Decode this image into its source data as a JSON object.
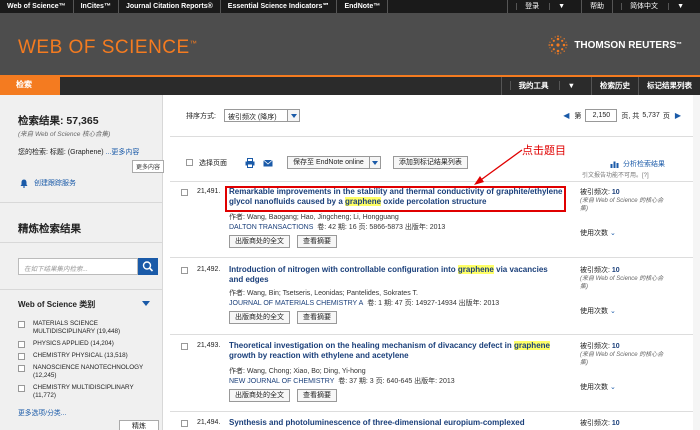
{
  "topbar": {
    "products": [
      "Web of Science™",
      "InCites™",
      "Journal Citation Reports®",
      "Essential Science Indicators℠",
      "EndNote™"
    ],
    "login": "登录",
    "help": "帮助",
    "language": "简体中文"
  },
  "header": {
    "logo": "WEB OF SCIENCE",
    "logo_tm": "™",
    "brand": "THOMSON REUTERS",
    "brand_tm": "™",
    "brand_color": "#f47b20"
  },
  "nav": {
    "active_tab": "检索",
    "links": [
      "我的工具",
      "检索历史",
      "标记结果列表"
    ]
  },
  "sidebar": {
    "results_label": "检索结果: 57,365",
    "results_sub": "(来自 Web of Science 核心合集)",
    "query_prefix": "您的检索: 标题: (Graphene)",
    "query_more": "...更多内容",
    "tooltip": "更多内容",
    "alert": "创建跟踪服务",
    "refine_title": "精炼检索结果",
    "refine_placeholder": "在如下结果集内检索...",
    "category_title": "Web of Science 类别",
    "categories": [
      "MATERIALS SCIENCE MULTIDISCIPLINARY (19,448)",
      "PHYSICS APPLIED (14,204)",
      "CHEMISTRY PHYSICAL (13,518)",
      "NANOSCIENCE NANOTECHNOLOGY (12,245)",
      "CHEMISTRY MULTIDISCIPLINARY (11,772)"
    ],
    "more_categories": "更多选项/分类...",
    "refine_button": "精炼"
  },
  "sort": {
    "label": "排序方式:",
    "value": "被引频次 (降序)"
  },
  "pager": {
    "page_label": "第",
    "page_value": "2,150",
    "total_label": "页, 共",
    "total": "5,737",
    "page_suffix": "页"
  },
  "toolbar": {
    "select_page": "选择页面",
    "save_label": "保存至 EndNote online",
    "add_label": "添加到标记结果列表"
  },
  "annotation": "点击题目",
  "analyze": {
    "label": "分析检索结果",
    "sub": "引文报告功能不可用。[?]"
  },
  "records": [
    {
      "num": "21,491.",
      "title_a": "Remarkable improvements in the stability and thermal conductivity of graphite/ethylene glycol nanofluids caused by a ",
      "title_hl": "graphene",
      "title_b": " oxide percolation structure",
      "authors": "作者: Wang, Baogang; Hao, Jingcheng; Li, Hongguang",
      "journal": "DALTON TRANSACTIONS",
      "details": "卷: 42  期: 16  页: 5866-5873  出版年: 2013",
      "btn1": "出版商处的全文",
      "btn2": "查看摘要",
      "cites_label": "被引频次: ",
      "cites": "10",
      "cites_sub": "(来自 Web of Science 的核心合集)",
      "usage": "使用次数"
    },
    {
      "num": "21,492.",
      "title_a": "Introduction of nitrogen with controllable configuration into ",
      "title_hl": "graphene",
      "title_b": " via vacancies and edges",
      "authors": "作者: Wang, Bin; Tsetseris, Leonidas; Pantelides, Sokrates T.",
      "journal": "JOURNAL OF MATERIALS CHEMISTRY A",
      "details": "卷: 1  期: 47  页: 14927-14934  出版年: 2013",
      "btn1": "出版商处的全文",
      "btn2": "查看摘要",
      "cites_label": "被引频次: ",
      "cites": "10",
      "cites_sub": "(来自 Web of Science 的核心合集)",
      "usage": "使用次数"
    },
    {
      "num": "21,493.",
      "title_a": "Theoretical investigation on the healing mechanism of divacancy defect in ",
      "title_hl": "graphene",
      "title_b": " growth by reaction with ethylene and acetylene",
      "authors": "作者: Wang, Chong; Xiao, Bo; Ding, Yi-hong",
      "journal": "NEW JOURNAL OF CHEMISTRY",
      "details": "卷: 37  期: 3  页: 640-645  出版年: 2013",
      "btn1": "出版商处的全文",
      "btn2": "查看摘要",
      "cites_label": "被引频次: ",
      "cites": "10",
      "cites_sub": "(来自 Web of Science 的核心合集)",
      "usage": "使用次数"
    },
    {
      "num": "21,494.",
      "title_a": "Synthesis and photoluminescence of three-dimensional europium-complexed",
      "title_hl": "",
      "title_b": "",
      "cites_label": "被引频次: ",
      "cites": "10"
    }
  ]
}
